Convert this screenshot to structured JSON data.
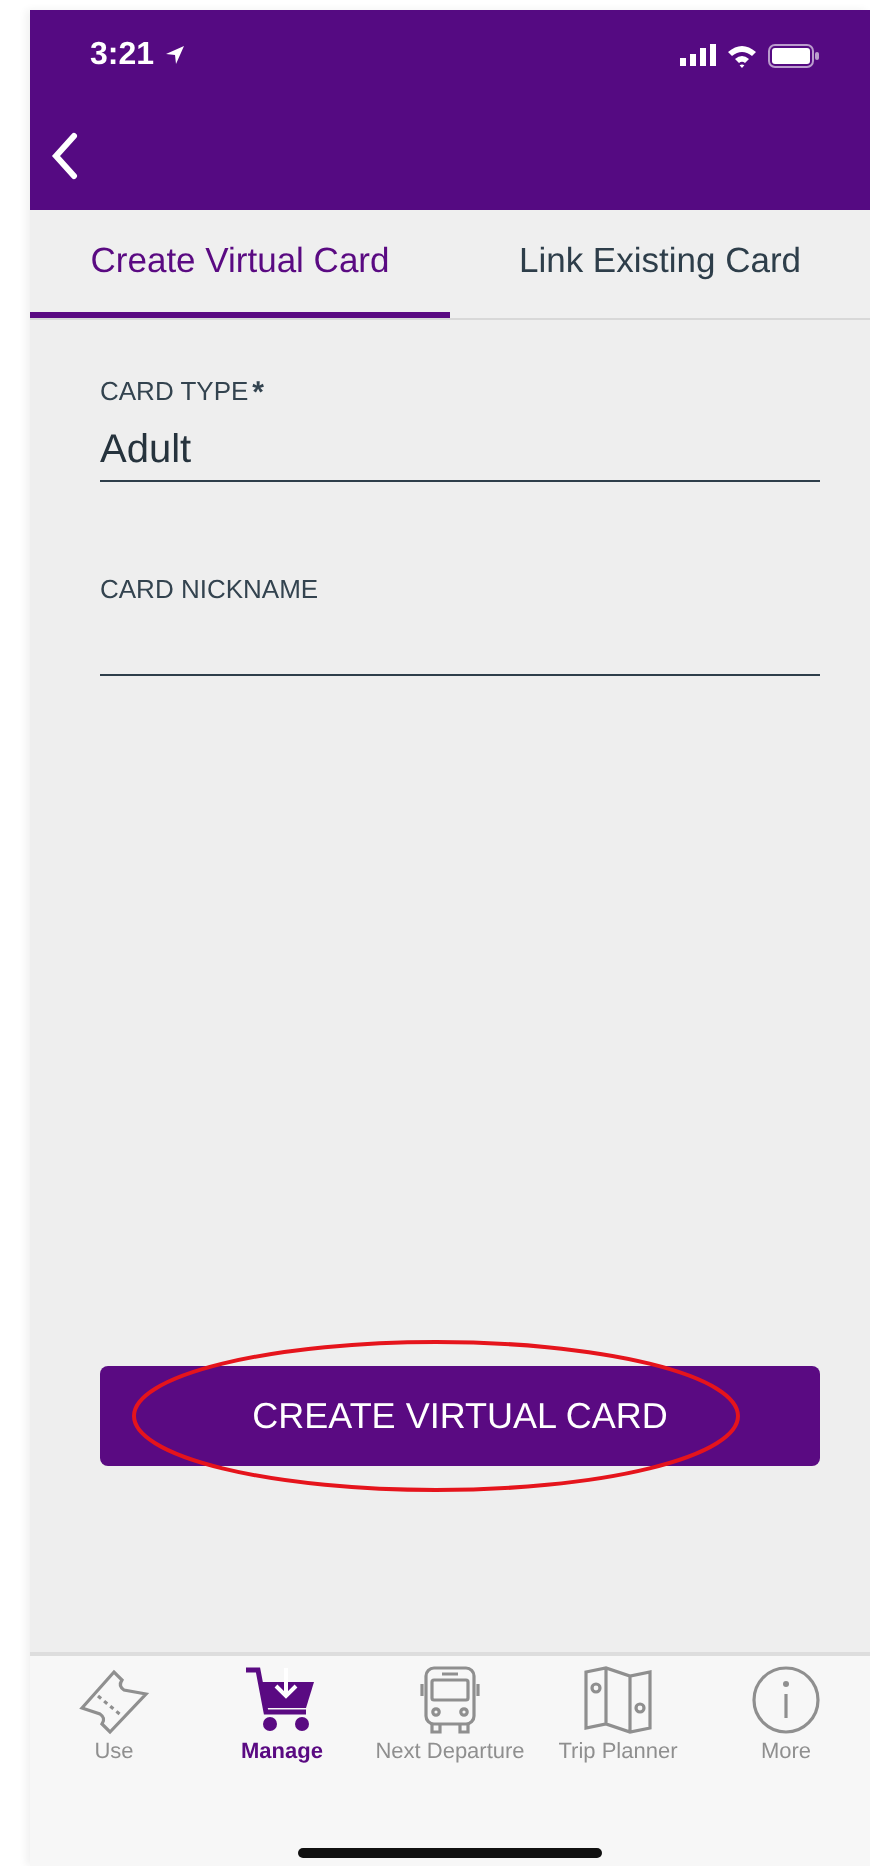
{
  "status_bar": {
    "time": "3:21"
  },
  "tabs": [
    {
      "label": "Create Virtual Card",
      "selected": true
    },
    {
      "label": "Link Existing Card",
      "selected": false
    }
  ],
  "fields": [
    {
      "label": "CARD TYPE",
      "required_mark": "*",
      "value": "Adult"
    },
    {
      "label": "CARD NICKNAME"
    }
  ],
  "submit_button": {
    "label": "CREATE VIRTUAL CARD",
    "highlighted": true
  },
  "tab_bar": [
    {
      "kind": "ticket",
      "label": "Use",
      "selected": false
    },
    {
      "kind": "cart",
      "label": "Manage",
      "selected": true
    },
    {
      "kind": "bus",
      "label": "Next Departure",
      "selected": false
    },
    {
      "kind": "map",
      "label": "Trip Planner",
      "selected": false
    },
    {
      "kind": "info",
      "label": "More",
      "selected": false
    }
  ]
}
